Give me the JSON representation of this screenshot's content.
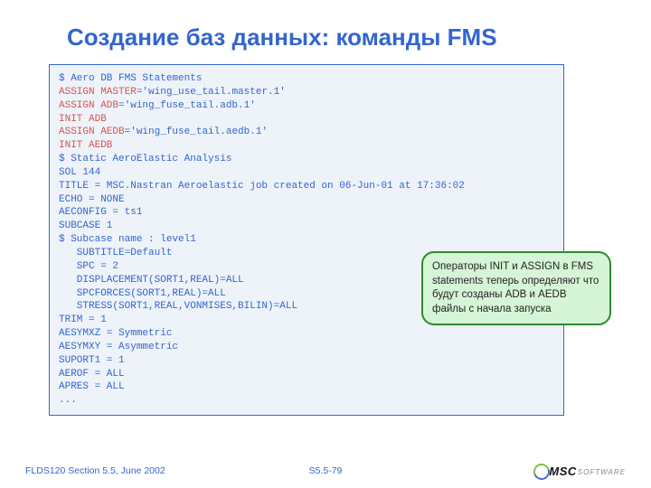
{
  "title": "Создание баз данных: команды FMS",
  "code": {
    "l01": "$ Aero DB FMS Statements",
    "l02a": "ASSIGN MASTER",
    "l02b": "='wing_use_tail.master.1'",
    "l03a": "ASSIGN ADB",
    "l03b": "='wing_fuse_tail.adb.1'",
    "l04": "INIT ADB",
    "l05a": "ASSIGN AEDB",
    "l05b": "='wing_fuse_tail.aedb.1'",
    "l06": "INIT AEDB",
    "l07": "$ Static AeroElastic Analysis",
    "l08": "SOL 144",
    "l09": "TITLE = MSC.Nastran Aeroelastic job created on 06-Jun-01 at 17:36:02",
    "l10": "ECHO = NONE",
    "l11": "AECONFIG = ts1",
    "l12": "SUBCASE 1",
    "l13": "$ Subcase name : level1",
    "l14": "   SUBTITLE=Default",
    "l15": "   SPC = 2",
    "l16": "   DISPLACEMENT(SORT1,REAL)=ALL",
    "l17": "   SPCFORCES(SORT1,REAL)=ALL",
    "l18": "   STRESS(SORT1,REAL,VONMISES,BILIN)=ALL",
    "l19": "TRIM = 1",
    "l20": "AESYMXZ = Symmetric",
    "l21": "AESYMXY = Asymmetric",
    "l22": "SUPORT1 = 1",
    "l23": "AEROF = ALL",
    "l24": "APRES = ALL",
    "l25": "..."
  },
  "callout": "Операторы INIT и ASSIGN в FMS statements теперь определяют что будут созданы ADB и AEDB файлы с начала запуска",
  "footer": {
    "left": "FLDS120 Section 5.5, June 2002",
    "center": "S5.5-79",
    "logo_main": "MSC",
    "logo_sub": "SOFTWARE"
  }
}
